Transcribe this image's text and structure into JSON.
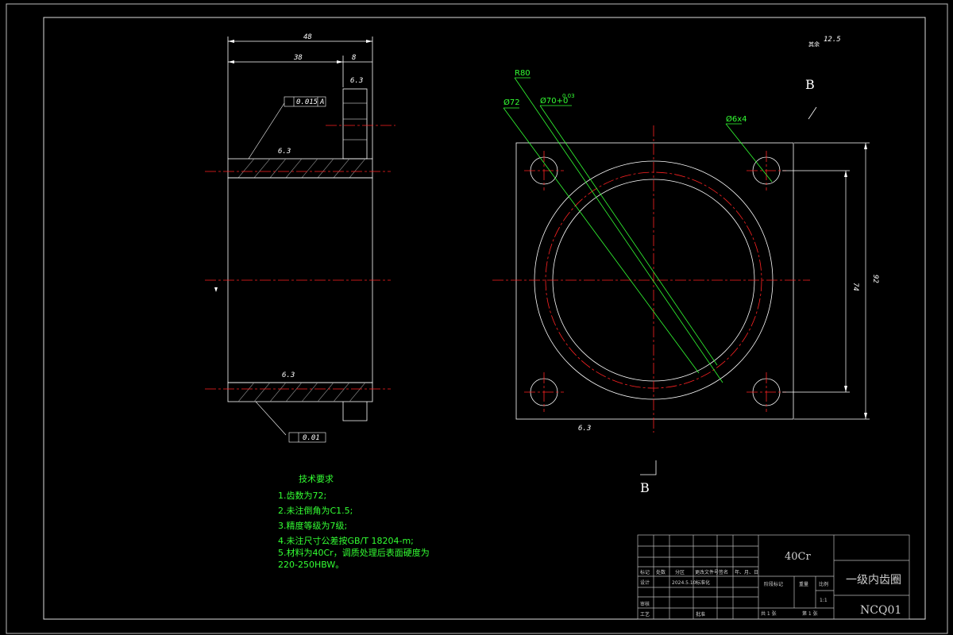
{
  "drawing": {
    "roughness_note": "其余",
    "roughness_value": "12.5",
    "section_label_top": "B",
    "section_label_bottom": "B",
    "datum_label": "A"
  },
  "side_view": {
    "dim_total": "48",
    "dim_left": "38",
    "dim_right": "8",
    "roughness_flange": "6.3",
    "roughness_top": "6.3",
    "roughness_bottom": "6.3",
    "tolerance_top": "0.015",
    "tolerance_top_datum": "A",
    "tolerance_bottom": "0.01"
  },
  "front_view": {
    "callout_bolt_circle": "R80",
    "callout_pitch": "Ø72",
    "callout_bore": "Ø70+0",
    "callout_bore_tol": "0.03",
    "callout_holes": "Ø6x4",
    "dim_hole_spacing": "74",
    "dim_plate_size": "92",
    "roughness_bottom": "6.3"
  },
  "technical_requirements": {
    "title": "技术要求",
    "items": [
      "1.齿数为72;",
      "2.未注倒角为C1.5;",
      "3.精度等级为7级;",
      "4.未注尺寸公差按GB/T 18204-m;",
      "5.材料为40Cr，调质处理后表面硬度为",
      "220-250HBW。"
    ]
  },
  "title_block": {
    "material": "40Cr",
    "part_name": "一级内齿圈",
    "drawing_number": "NCQ01",
    "row_labels": {
      "mark": "标记",
      "count": "处数",
      "zone": "分区",
      "change_doc": "更改文件号",
      "signature": "签名",
      "date": "年、月、日",
      "design": "设计",
      "standardization": "标准化",
      "review": "审核",
      "process": "工艺",
      "approve": "批准",
      "stage_mark": "阶段标记",
      "weight": "重量",
      "scale": "比例",
      "scale_value": "1:1",
      "total_sheets": "共 1 张",
      "sheet_no": "第 1 张"
    },
    "design_date": "2024.5.10"
  }
}
